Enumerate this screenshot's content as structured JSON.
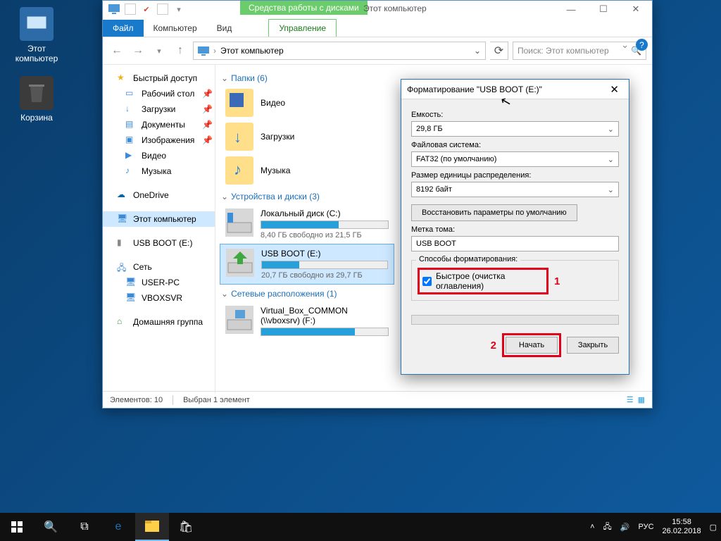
{
  "desktop": {
    "this_pc": "Этот компьютер",
    "recycle": "Корзина"
  },
  "explorer": {
    "disk_tools": "Средства работы с дисками",
    "title": "Этот компьютер",
    "tabs": {
      "file": "Файл",
      "computer": "Компьютер",
      "view": "Вид",
      "manage": "Управление"
    },
    "breadcrumb": "Этот компьютер",
    "search_placeholder": "Поиск: Этот компьютер",
    "nav": {
      "quick": "Быстрый доступ",
      "desktop": "Рабочий стол",
      "downloads": "Загрузки",
      "documents": "Документы",
      "pictures": "Изображения",
      "video": "Видео",
      "music": "Музыка",
      "onedrive": "OneDrive",
      "thispc": "Этот компьютер",
      "usb": "USB BOOT (E:)",
      "network": "Сеть",
      "userpc": "USER-PC",
      "vbox": "VBOXSVR",
      "homegroup": "Домашняя группа"
    },
    "groups": {
      "folders_hdr": "Папки (6)",
      "drives_hdr": "Устройства и диски (3)",
      "net_hdr": "Сетевые расположения (1)"
    },
    "folders": {
      "video": "Видео",
      "downloads": "Загрузки",
      "music": "Музыка"
    },
    "drives": {
      "c_name": "Локальный диск (C:)",
      "c_stat": "8,40 ГБ свободно из 21,5 ГБ",
      "c_fill": 61,
      "e_name": "USB BOOT (E:)",
      "e_stat": "20,7 ГБ свободно из 29,7 ГБ",
      "e_fill": 30
    },
    "net": {
      "share_name": "Virtual_Box_COMMON (\\\\vboxsrv) (F:)",
      "share_fill": 74
    },
    "status": {
      "items": "Элементов: 10",
      "selected": "Выбран 1 элемент"
    }
  },
  "format": {
    "title": "Форматирование \"USB BOOT (E:)\"",
    "capacity_lbl": "Емкость:",
    "capacity_val": "29,8 ГБ",
    "fs_lbl": "Файловая система:",
    "fs_val": "FAT32 (по умолчанию)",
    "cluster_lbl": "Размер единицы распределения:",
    "cluster_val": "8192 байт",
    "restore_defaults": "Восстановить параметры по умолчанию",
    "label_lbl": "Метка тома:",
    "label_val": "USB BOOT",
    "methods_lbl": "Способы форматирования:",
    "quick": "Быстрое (очистка оглавления)",
    "callout1": "1",
    "callout2": "2",
    "start": "Начать",
    "close": "Закрыть"
  },
  "taskbar": {
    "lang": "РУС",
    "time": "15:58",
    "date": "26.02.2018"
  }
}
